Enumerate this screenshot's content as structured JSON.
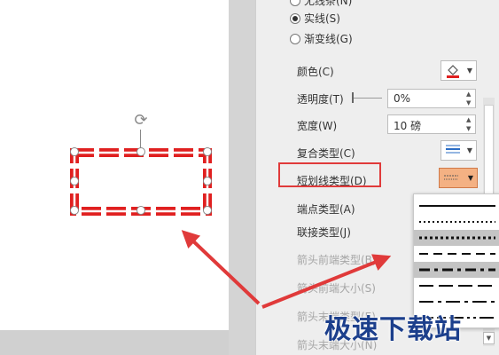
{
  "panel": {
    "line_options": {
      "no_line_label": "无线条(N)",
      "solid_line_label": "实线(S)",
      "gradient_line_label": "渐变线(G)"
    },
    "color_label": "颜色(C)",
    "transparency_label": "透明度(T)",
    "transparency_value": "0%",
    "width_label": "宽度(W)",
    "width_value": "10 磅",
    "compound_type_label": "复合类型(C)",
    "dash_type_label": "短划线类型(D)",
    "cap_type_label": "端点类型(A)",
    "join_type_label": "联接类型(J)",
    "begin_arrow_type_label": "箭头前端类型(B)",
    "begin_arrow_size_label": "箭头前端大小(S)",
    "end_arrow_type_label": "箭头末端类型(E)",
    "end_arrow_size_label": "箭头末端大小(N)"
  },
  "dash_options": [
    "solid",
    "round-dot",
    "square-dot",
    "dash",
    "dash-dot",
    "long-dash",
    "long-dash-dot",
    "long-dash-dot-dot"
  ],
  "selected_dash": "dash-dot",
  "colors": {
    "accent_red": "#e03a3a",
    "line_color": "#e02020",
    "dropdown_highlight": "#f4b183"
  },
  "watermark": "极速下载站"
}
